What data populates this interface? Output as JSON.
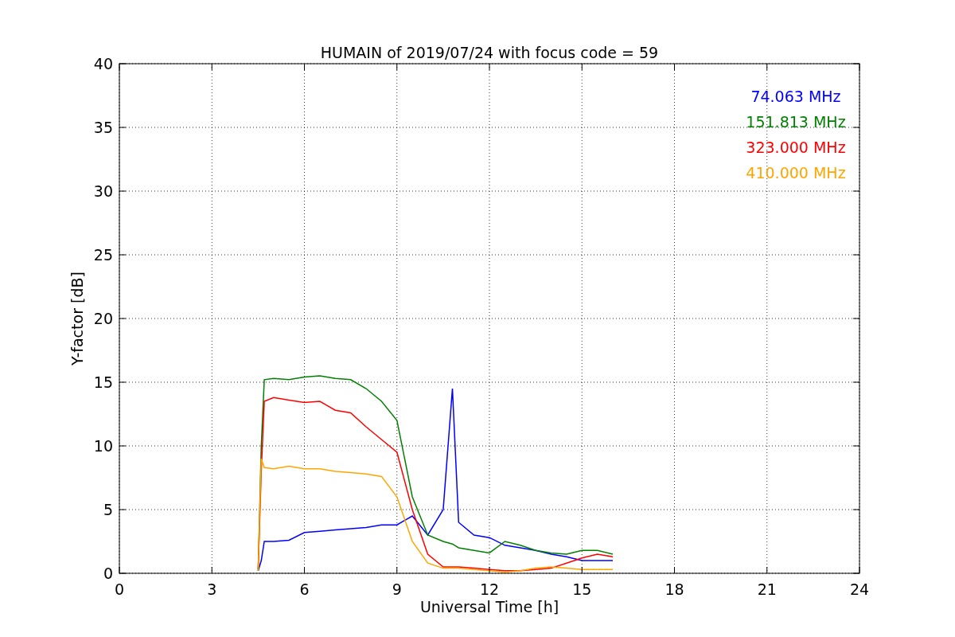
{
  "chart_data": {
    "type": "line",
    "title": "HUMAIN of 2019/07/24 with focus code = 59",
    "xlabel": "Universal Time [h]",
    "ylabel": "Y-factor [dB]",
    "x": [
      4.5,
      4.6,
      4.7,
      5,
      5.5,
      6,
      6.5,
      7,
      7.5,
      8,
      8.5,
      9,
      9.5,
      10,
      10.5,
      10.8,
      11,
      11.5,
      12,
      12.5,
      13,
      13.5,
      14,
      14.5,
      15,
      15.5,
      16
    ],
    "series": [
      {
        "name": "74.063 MHz",
        "color": "#0000ff",
        "values": [
          0.2,
          1,
          2.5,
          2.5,
          2.6,
          3.2,
          3.3,
          3.4,
          3.5,
          3.6,
          3.8,
          3.8,
          4.5,
          3,
          5,
          14.5,
          4,
          3,
          2.8,
          2.2,
          2,
          1.8,
          1.5,
          1.3,
          1,
          1,
          1
        ]
      },
      {
        "name": "151.813 MHz",
        "color": "#008000",
        "values": [
          0.2,
          10,
          15.2,
          15.3,
          15.2,
          15.4,
          15.5,
          15.3,
          15.2,
          14.5,
          13.5,
          12,
          6,
          3,
          2.5,
          2.3,
          2,
          1.8,
          1.6,
          2.5,
          2.2,
          1.8,
          1.6,
          1.5,
          1.8,
          1.8,
          1.5
        ]
      },
      {
        "name": "323.000 MHz",
        "color": "#ff0000",
        "values": [
          0.3,
          8,
          13.5,
          13.8,
          13.6,
          13.4,
          13.5,
          12.8,
          12.6,
          11.5,
          10.5,
          9.5,
          5,
          1.5,
          0.5,
          0.5,
          0.5,
          0.4,
          0.3,
          0.2,
          0.2,
          0.3,
          0.4,
          0.8,
          1.2,
          1.5,
          1.3
        ]
      },
      {
        "name": "410.000 MHz",
        "color": "#ffa500",
        "values": [
          0.2,
          9,
          8.3,
          8.2,
          8.4,
          8.2,
          8.2,
          8,
          7.9,
          7.8,
          7.6,
          6,
          2.5,
          0.8,
          0.4,
          0.4,
          0.4,
          0.3,
          0.2,
          0.1,
          0.2,
          0.4,
          0.5,
          0.4,
          0.3,
          0.3,
          0.3
        ]
      }
    ],
    "grid": true,
    "xlim": [
      0,
      24
    ],
    "ylim": [
      0,
      40
    ],
    "xticks": [
      0,
      3,
      6,
      9,
      12,
      15,
      18,
      21,
      24
    ],
    "yticks": [
      0,
      5,
      10,
      15,
      20,
      25,
      30,
      35,
      40
    ]
  }
}
